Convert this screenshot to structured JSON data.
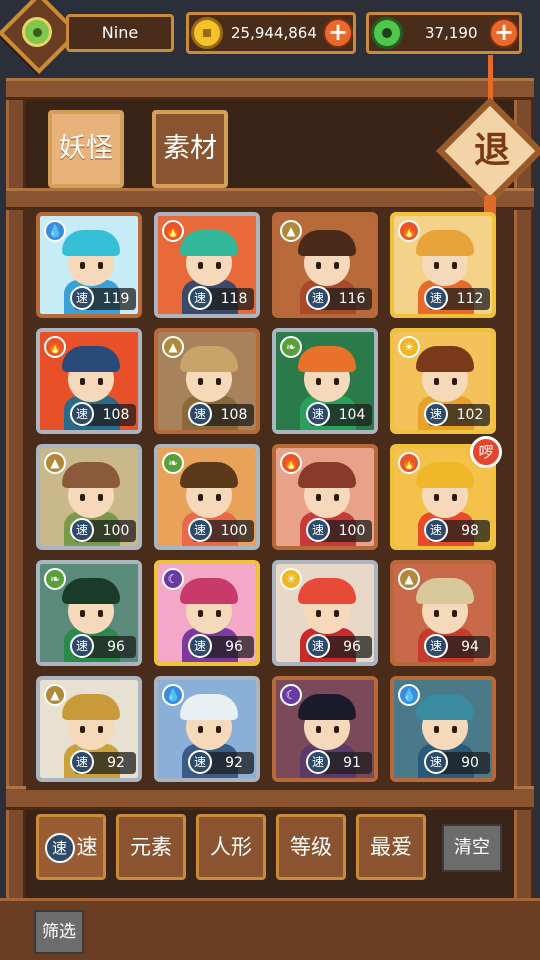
{
  "player": {
    "name": "Nine"
  },
  "resources": {
    "gold": "25,944,864",
    "jade": "37,190",
    "add_label": "+"
  },
  "tabs": [
    {
      "label": "妖怪",
      "active": true
    },
    {
      "label": "素材",
      "active": false
    }
  ],
  "exit_label": "退",
  "speed_icon_label": "速",
  "hot_label": "啰",
  "characters": [
    {
      "element": "water",
      "rarity": "bronze",
      "speed": "119",
      "hair": "#36c0d8",
      "outfit": "#3aa0d8",
      "bg": "#c8ecf6"
    },
    {
      "element": "fire",
      "rarity": "silver",
      "speed": "118",
      "hair": "#34b89a",
      "outfit": "#3a4a6a",
      "bg": "#e86a3a"
    },
    {
      "element": "earth",
      "rarity": "bronze",
      "speed": "116",
      "hair": "#4a2a18",
      "outfit": "#a84a2a",
      "bg": "#b86a3a"
    },
    {
      "element": "fire",
      "rarity": "gold",
      "speed": "112",
      "hair": "#e8a23a",
      "outfit": "#e86a2a",
      "bg": "#f4d28a"
    },
    {
      "element": "fire",
      "rarity": "silver",
      "speed": "108",
      "hair": "#2a4a7a",
      "outfit": "#2a6a8a",
      "bg": "#e8502a"
    },
    {
      "element": "earth",
      "rarity": "bronze",
      "speed": "108",
      "hair": "#c8a46a",
      "outfit": "#8a6a3a",
      "bg": "#a8825a"
    },
    {
      "element": "wood",
      "rarity": "silver",
      "speed": "104",
      "hair": "#e8722a",
      "outfit": "#2aa05a",
      "bg": "#2a7a4a"
    },
    {
      "element": "light",
      "rarity": "gold",
      "speed": "102",
      "hair": "#7a3a1a",
      "outfit": "#e8a22a",
      "bg": "#f4c25a"
    },
    {
      "element": "earth",
      "rarity": "silver",
      "speed": "100",
      "hair": "#8a5a3a",
      "outfit": "#7a9a4a",
      "bg": "#c8b88a"
    },
    {
      "element": "wood",
      "rarity": "silver",
      "speed": "100",
      "hair": "#5a3a1a",
      "outfit": "#e86a4a",
      "bg": "#e8a25a"
    },
    {
      "element": "fire",
      "rarity": "bronze",
      "speed": "100",
      "hair": "#8a3a2a",
      "outfit": "#c83a3a",
      "bg": "#e8a28a"
    },
    {
      "element": "fire",
      "rarity": "gold",
      "speed": "98",
      "hair": "#f0b72a",
      "outfit": "#e84a2a",
      "bg": "#f4c24a"
    },
    {
      "element": "wood",
      "rarity": "silver",
      "speed": "96",
      "hair": "#1a3a2a",
      "outfit": "#2a8a4a",
      "bg": "#5a8a7a"
    },
    {
      "element": "dark",
      "rarity": "gold",
      "speed": "96",
      "hair": "#c83a6a",
      "outfit": "#7a3aa0",
      "bg": "#f4a8c8"
    },
    {
      "element": "light",
      "rarity": "silver",
      "speed": "96",
      "hair": "#e84a3a",
      "outfit": "#c82a2a",
      "bg": "#e8d8c8"
    },
    {
      "element": "earth",
      "rarity": "bronze",
      "speed": "94",
      "hair": "#d8c89a",
      "outfit": "#c83a2a",
      "bg": "#c86a4a"
    },
    {
      "element": "earth",
      "rarity": "silver",
      "speed": "92",
      "hair": "#c89a3a",
      "outfit": "#c8a23a",
      "bg": "#e8e0d0"
    },
    {
      "element": "water",
      "rarity": "silver",
      "speed": "92",
      "hair": "#e8f0f4",
      "outfit": "#3a5a8a",
      "bg": "#8ab0d8"
    },
    {
      "element": "dark",
      "rarity": "bronze",
      "speed": "91",
      "hair": "#1a1a2a",
      "outfit": "#5a3a6a",
      "bg": "#7a4a5a"
    },
    {
      "element": "water",
      "rarity": "bronze",
      "speed": "90",
      "hair": "#3a8aa0",
      "outfit": "#2a5a7a",
      "bg": "#4a7a8a"
    }
  ],
  "sort_buttons": [
    {
      "label": "速",
      "active": true
    },
    {
      "label": "元素",
      "active": false
    },
    {
      "label": "人形",
      "active": false
    },
    {
      "label": "等级",
      "active": false
    },
    {
      "label": "最爱",
      "active": false
    }
  ],
  "clear_label": "清空",
  "filter_label": "筛选"
}
